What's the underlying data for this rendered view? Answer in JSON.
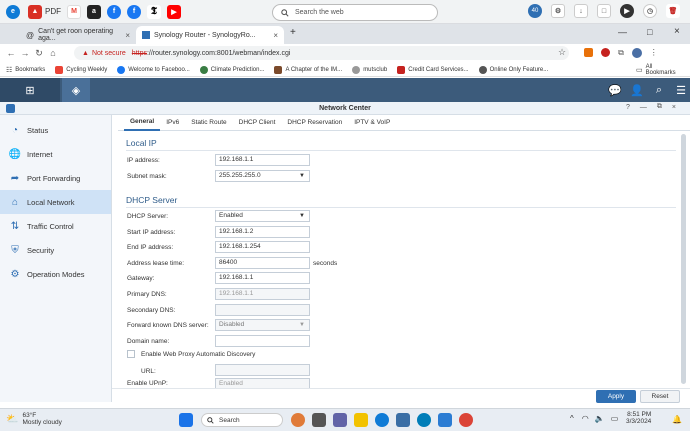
{
  "top_taskbar": {
    "items": [
      {
        "label": "",
        "icon": "edge-icon",
        "color": "#0f7bd6"
      },
      {
        "label": "PDF",
        "icon": "pdf-icon",
        "color": "#d93025"
      },
      {
        "label": "",
        "icon": "gmail-icon",
        "color": "#ea4335"
      },
      {
        "label": "",
        "icon": "amazon-icon",
        "color": "#222222"
      },
      {
        "label": "",
        "icon": "facebook-icon",
        "color": "#1877f2"
      },
      {
        "label": "",
        "icon": "facebook-icon",
        "color": "#1877f2"
      },
      {
        "label": "",
        "icon": "nyt-icon",
        "color": "#000000"
      },
      {
        "label": "",
        "icon": "youtube-icon",
        "color": "#ff0000"
      }
    ],
    "search_placeholder": "Search the web",
    "badge_count": "40"
  },
  "browser_tabs": [
    {
      "title": "Can't get roon operating aga...",
      "active": false
    },
    {
      "title": "Synology Router - SynologyRo...",
      "active": true
    }
  ],
  "address_bar": {
    "not_secure": "Not secure",
    "url_scheme": "https",
    "url_rest": "://router.synology.com:8001/webman/index.cgi"
  },
  "bookmarks": {
    "items": [
      "Bookmarks",
      "Cycling Weekly",
      "Welcome to Faceboo...",
      "Climate Prediction...",
      "A Chapter of the IM...",
      "mutsclub",
      "Credit Card Services...",
      "Online Only Feature..."
    ],
    "all_bookmarks": "All Bookmarks"
  },
  "window": {
    "title": "Network Center"
  },
  "sidebar": {
    "items": [
      {
        "label": "Status",
        "icon": "status-icon",
        "active": false
      },
      {
        "label": "Internet",
        "icon": "globe-icon",
        "active": false
      },
      {
        "label": "Port Forwarding",
        "icon": "port-forwarding-icon",
        "active": false
      },
      {
        "label": "Local Network",
        "icon": "home-network-icon",
        "active": true
      },
      {
        "label": "Traffic Control",
        "icon": "traffic-control-icon",
        "active": false
      },
      {
        "label": "Security",
        "icon": "shield-icon",
        "active": false
      },
      {
        "label": "Operation Modes",
        "icon": "operation-modes-icon",
        "active": false
      }
    ]
  },
  "content_tabs": [
    {
      "label": "General",
      "active": true
    },
    {
      "label": "IPv6",
      "active": false
    },
    {
      "label": "Static Route",
      "active": false
    },
    {
      "label": "DHCP Client",
      "active": false
    },
    {
      "label": "DHCP Reservation",
      "active": false
    },
    {
      "label": "IPTV & VoIP",
      "active": false
    }
  ],
  "local_ip": {
    "heading": "Local IP",
    "ip_label": "IP address:",
    "ip_value": "192.168.1.1",
    "mask_label": "Subnet mask:",
    "mask_value": "255.255.255.0"
  },
  "dhcp": {
    "heading": "DHCP Server",
    "server_label": "DHCP Server:",
    "server_value": "Enabled",
    "start_label": "Start IP address:",
    "start_value": "192.168.1.2",
    "end_label": "End IP address:",
    "end_value": "192.168.1.254",
    "lease_label": "Address lease time:",
    "lease_value": "86400",
    "lease_unit": "seconds",
    "gateway_label": "Gateway:",
    "gateway_value": "192.168.1.1",
    "primary_dns_label": "Primary DNS:",
    "primary_dns_value": "192.168.1.1",
    "secondary_dns_label": "Secondary DNS:",
    "secondary_dns_value": "",
    "forward_label": "Forward known DNS server:",
    "forward_value": "Disabled",
    "domain_label": "Domain name:",
    "domain_value": "",
    "wpad_label": "Enable Web Proxy Automatic Discovery",
    "url_label": "URL:",
    "url_value": "",
    "upnp_label": "Enable UPnP:",
    "upnp_value": "Enabled"
  },
  "buttons": {
    "apply": "Apply",
    "reset": "Reset"
  },
  "windows_taskbar": {
    "weather_temp": "63°F",
    "weather_desc": "Mostly cloudy",
    "search": "Search",
    "time": "8:51 PM",
    "date": "3/3/2024"
  }
}
